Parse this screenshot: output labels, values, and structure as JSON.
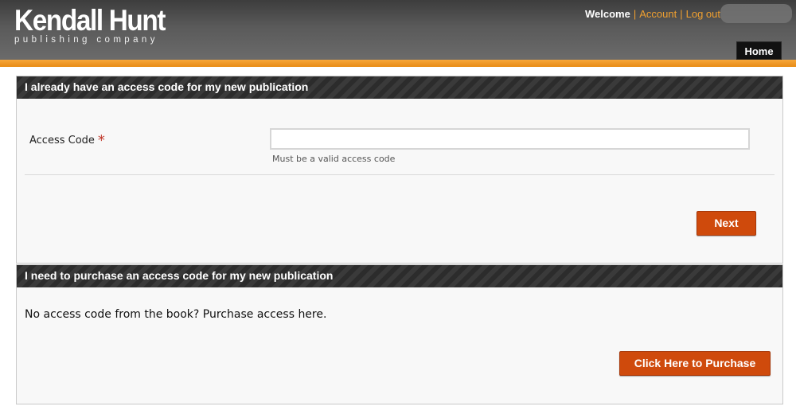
{
  "header": {
    "logo_main": "Kendall Hunt",
    "logo_sub": "publishing company",
    "welcome": "Welcome",
    "separator": "|",
    "account_link": "Account",
    "logout_link": "Log out",
    "home_tab": "Home"
  },
  "access_panel": {
    "title": "I already have an access code for my new publication",
    "field_label": "Access Code",
    "required_mark": "*",
    "input_value": "",
    "input_placeholder": "",
    "help_text": "Must be a valid access code",
    "next_button": "Next"
  },
  "purchase_panel": {
    "title": "I need to purchase an access code for my new publication",
    "body_text": "No access code from the book? Purchase access here.",
    "purchase_button": "Click Here to Purchase"
  },
  "colors": {
    "accent_orange": "#f0a030",
    "button_orange": "#cf4a0c",
    "header_dark": "#2c2c2c"
  }
}
